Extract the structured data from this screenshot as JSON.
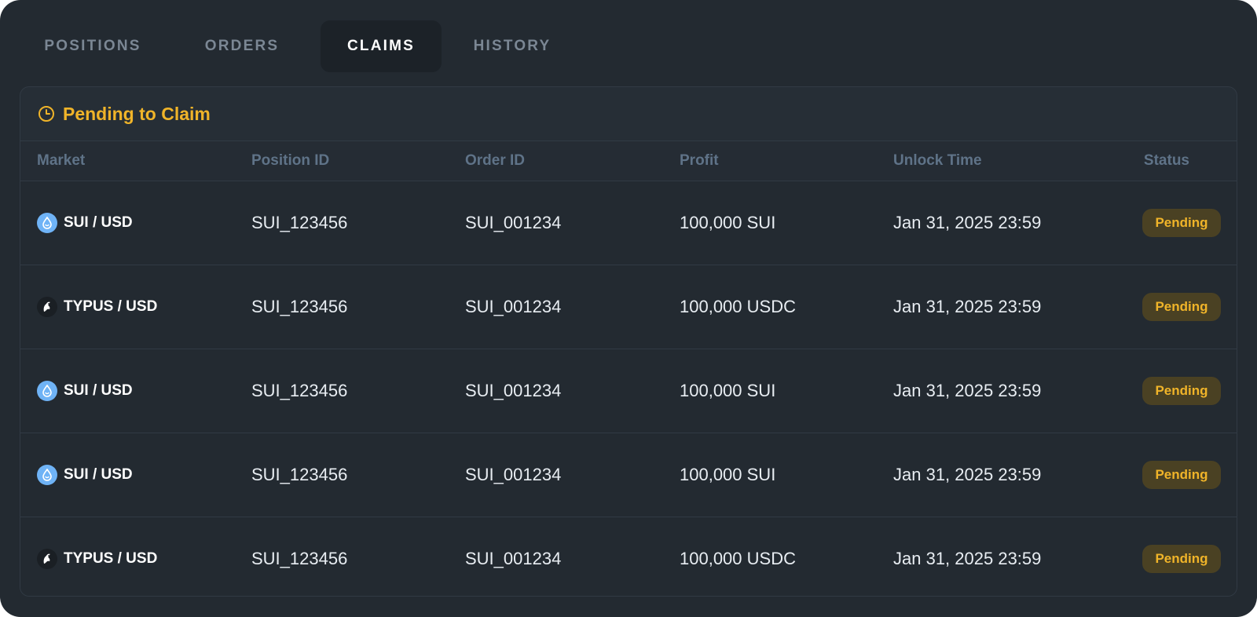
{
  "tabs": [
    {
      "label": "POSITIONS",
      "active": false
    },
    {
      "label": "ORDERS",
      "active": false
    },
    {
      "label": "CLAIMS",
      "active": true
    },
    {
      "label": "HISTORY",
      "active": false
    }
  ],
  "card": {
    "title": "Pending to Claim",
    "title_icon": "clock-icon"
  },
  "table": {
    "headers": [
      "Market",
      "Position ID",
      "Order ID",
      "Profit",
      "Unlock Time",
      "Status"
    ],
    "rows": [
      {
        "market": "SUI / USD",
        "icon": "sui-icon",
        "position_id": "SUI_123456",
        "order_id": "SUI_001234",
        "profit": "100,000 SUI",
        "unlock_time": "Jan 31, 2025 23:59",
        "status": "Pending"
      },
      {
        "market": "TYPUS / USD",
        "icon": "typus-icon",
        "position_id": "SUI_123456",
        "order_id": "SUI_001234",
        "profit": "100,000 USDC",
        "unlock_time": "Jan 31, 2025 23:59",
        "status": "Pending"
      },
      {
        "market": "SUI / USD",
        "icon": "sui-icon",
        "position_id": "SUI_123456",
        "order_id": "SUI_001234",
        "profit": "100,000 SUI",
        "unlock_time": "Jan 31, 2025 23:59",
        "status": "Pending"
      },
      {
        "market": "SUI / USD",
        "icon": "sui-icon",
        "position_id": "SUI_123456",
        "order_id": "SUI_001234",
        "profit": "100,000 SUI",
        "unlock_time": "Jan 31, 2025 23:59",
        "status": "Pending"
      },
      {
        "market": "TYPUS / USD",
        "icon": "typus-icon",
        "position_id": "SUI_123456",
        "order_id": "SUI_001234",
        "profit": "100,000 USDC",
        "unlock_time": "Jan 31, 2025 23:59",
        "status": "Pending"
      }
    ]
  },
  "colors": {
    "accent": "#f0b429",
    "background": "#232a31",
    "header_text": "#5f7388"
  }
}
